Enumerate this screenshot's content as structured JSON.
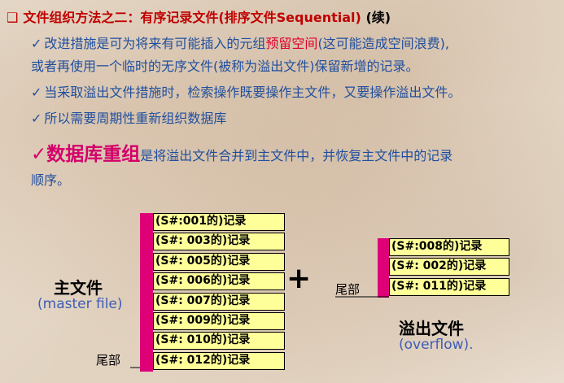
{
  "heading": {
    "bullet": "❑",
    "text": "文件组织方法之二：有序记录文件(排序文件Sequential)",
    "suffix": "(续)"
  },
  "lines": {
    "l1_a": "改进措施是可为将来有可能插入的元组",
    "l1_b": "预留空间",
    "l1_c": "(这可能造成空间浪费),",
    "l2": "或者再使用一个临时的无序文件(被称为溢出文件)保留新增的记录。",
    "l3": "当采取溢出文件措施时，检索操作既要操作主文件，又要操作溢出文件。",
    "l4": "所以需要周期性重新组织数据库",
    "l5_title": "数据库重组",
    "l5_rest": "是将溢出文件合并到主文件中，并恢复主文件中的记录",
    "l6": "顺序。"
  },
  "check": "✓",
  "master": {
    "label": "主文件",
    "sublabel": "(master file)",
    "tail": "尾部",
    "records": [
      "(S#:001的)记录",
      "(S#: 003的)记录",
      "(S#: 005的)记录",
      "(S#: 006的)记录",
      "(S#: 007的)记录",
      "(S#: 009的)记录",
      "(S#: 010的)记录",
      "(S#: 012的)记录"
    ]
  },
  "plus": "+",
  "overflow": {
    "label": "溢出文件",
    "sublabel": "(overflow).",
    "tail": "尾部",
    "records": [
      "(S#:008的)记录",
      "(S#: 002的)记录",
      "(S#: 011的)记录"
    ]
  },
  "colors": {
    "heading": "#c00000",
    "body_text": "#1f4e9e",
    "highlight": "#e0002a",
    "reorg": "#d4006a",
    "record_fill": "#ffff99",
    "bar": "#dd0077"
  }
}
